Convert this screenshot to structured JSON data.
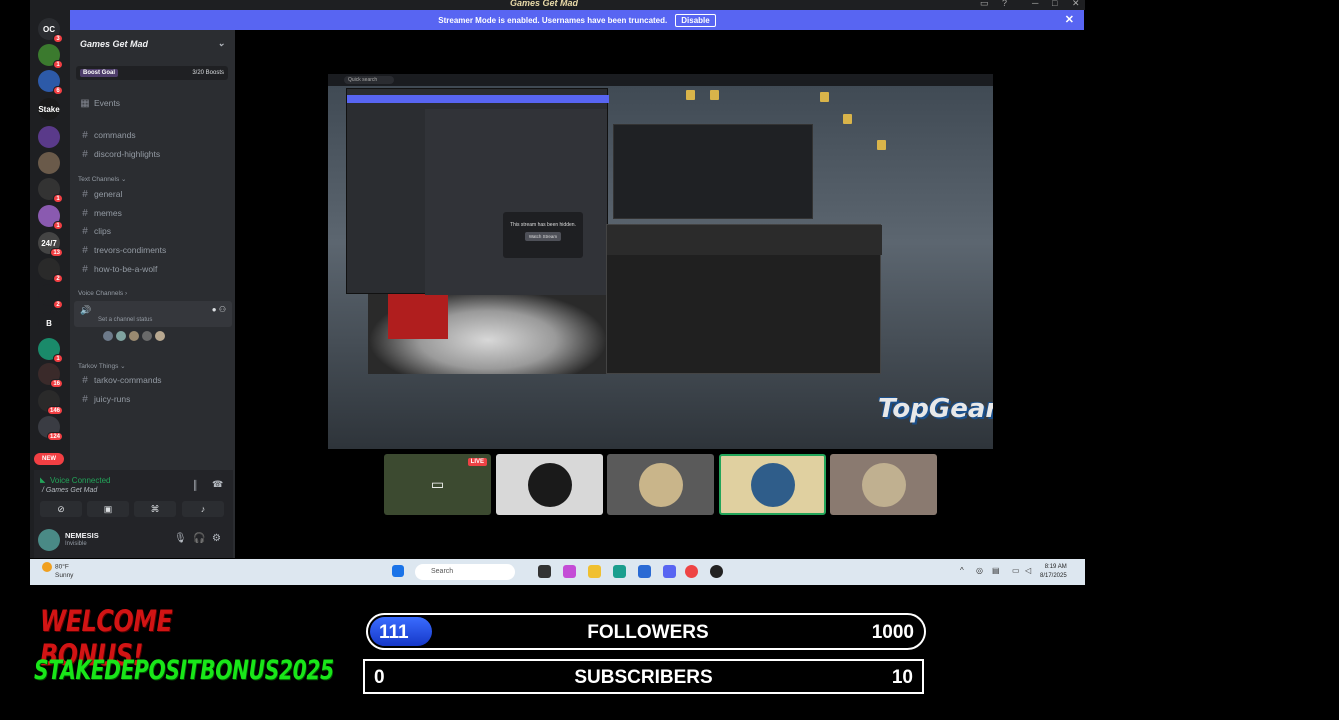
{
  "window": {
    "title": "Games Get Mad"
  },
  "banner": {
    "text": "Streamer Mode is enabled. Usernames have been truncated.",
    "button": "Disable"
  },
  "rail": {
    "servers": [
      {
        "label": "OC",
        "badge": "3"
      },
      {
        "label": "",
        "badge": "1"
      },
      {
        "label": "",
        "badge": "6"
      },
      {
        "label": "Stake",
        "badge": ""
      },
      {
        "label": "",
        "badge": ""
      },
      {
        "label": "",
        "badge": ""
      },
      {
        "label": "",
        "badge": "1"
      },
      {
        "label": "",
        "badge": "1"
      },
      {
        "label": "24/7",
        "badge": "13"
      },
      {
        "label": "",
        "badge": "2"
      },
      {
        "label": "",
        "badge": "2"
      },
      {
        "label": "B",
        "badge": ""
      },
      {
        "label": "",
        "badge": "1"
      },
      {
        "label": "",
        "badge": "16"
      },
      {
        "label": "",
        "badge": "146"
      },
      {
        "label": "",
        "badge": "124"
      }
    ],
    "new_label": "NEW"
  },
  "sidebar": {
    "server_name": "Games Get Mad",
    "boost_label": "Boost Goal",
    "boost_count": "3/20 Boosts",
    "events": "Events",
    "top_channels": [
      "commands",
      "discord-highlights"
    ],
    "text_category": "Text Channels",
    "text_channels": [
      "general",
      "memes",
      "clips",
      "trevors-condiments",
      "how-to-be-a-wolf"
    ],
    "voice_category": "Voice Channels",
    "voice_status": "Set a channel status",
    "tarkov_category": "Tarkov Things",
    "tarkov_channels": [
      "tarkov-commands",
      "juicy-runs"
    ]
  },
  "voice_panel": {
    "status": "Voice Connected",
    "location": "/ Games Get Mad"
  },
  "user": {
    "name": "NEMESIS",
    "status": "Invisible"
  },
  "stream": {
    "search_label": "Quick search",
    "hidden_text": "This stream has been hidden.",
    "watch_button": "Watch Stream",
    "logo_text": "TopGear",
    "live_badge": "LIVE"
  },
  "taskbar": {
    "temp": "80°F",
    "weather": "Sunny",
    "search_placeholder": "Search",
    "time": "8:19 AM",
    "date": "8/17/2025"
  },
  "overlay": {
    "welcome": "WELCOME BONUS!",
    "code": "STAKEDEPOSITBONUS2025",
    "followers": {
      "current": "111",
      "label": "FOLLOWERS",
      "goal": "1000",
      "progress": 0.111
    },
    "subscribers": {
      "current": "0",
      "label": "SUBSCRIBERS",
      "goal": "10",
      "progress": 0
    }
  },
  "colors": {
    "discord_blurple": "#5865f2",
    "voice_green": "#23a55a",
    "badge_red": "#f23f43",
    "welcome_red": "#d21414",
    "code_green": "#19e619",
    "followers_blue": "#2a52e6"
  }
}
